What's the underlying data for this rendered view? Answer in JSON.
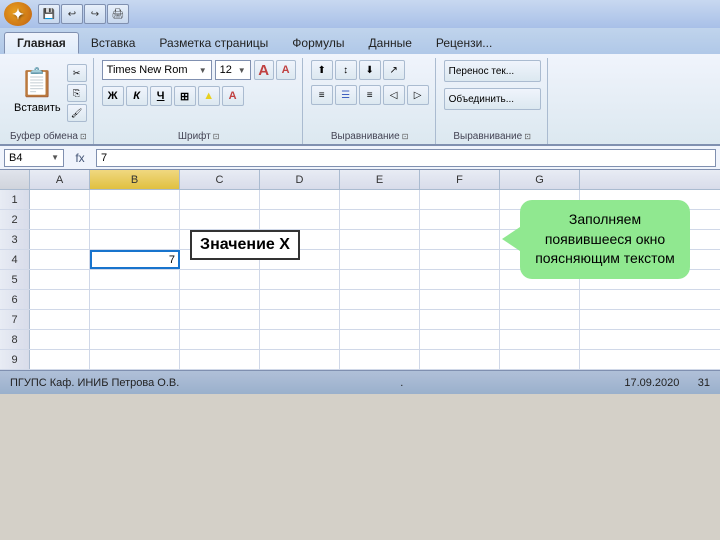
{
  "titleBar": {
    "toolbarBtns": [
      "⟵",
      "⟶",
      "💾",
      "🖨",
      "↩",
      "↪"
    ]
  },
  "ribbon": {
    "tabs": [
      {
        "label": "Главная",
        "active": true
      },
      {
        "label": "Вставка",
        "active": false
      },
      {
        "label": "Разметка страницы",
        "active": false
      },
      {
        "label": "Формулы",
        "active": false
      },
      {
        "label": "Данные",
        "active": false
      },
      {
        "label": "Рецензи...",
        "active": false
      }
    ],
    "groups": {
      "clipboard": {
        "label": "Буфер обмена",
        "paste": "Вставить"
      },
      "font": {
        "label": "Шрифт",
        "fontName": "Times New Rom",
        "fontSize": "12",
        "boldLabel": "Ж",
        "italicLabel": "К",
        "underlineLabel": "Ч"
      },
      "alignment": {
        "label": "Выравнивание"
      },
      "wrapMerge": {
        "wrapLabel": "Перенос тек...",
        "mergeLabel": "Объединить..."
      }
    }
  },
  "formulaBar": {
    "cellRef": "B4",
    "formula": "7",
    "fxLabel": "fx"
  },
  "grid": {
    "columns": [
      "A",
      "B",
      "C",
      "D",
      "E",
      "F",
      "G"
    ],
    "rows": [
      1,
      2,
      3,
      4,
      5,
      6,
      7,
      8,
      9
    ],
    "activeCell": "B4",
    "activeCellValue": "7"
  },
  "callout": {
    "boxLabel": "Значение X",
    "bubbleText": "Заполняем появившееся окно поясняющим текстом"
  },
  "footer": {
    "left": "ПГУПС  Каф. ИНИБ  Петрова О.В.",
    "center": ".",
    "right": "17.09.2020",
    "pageNum": "31"
  }
}
